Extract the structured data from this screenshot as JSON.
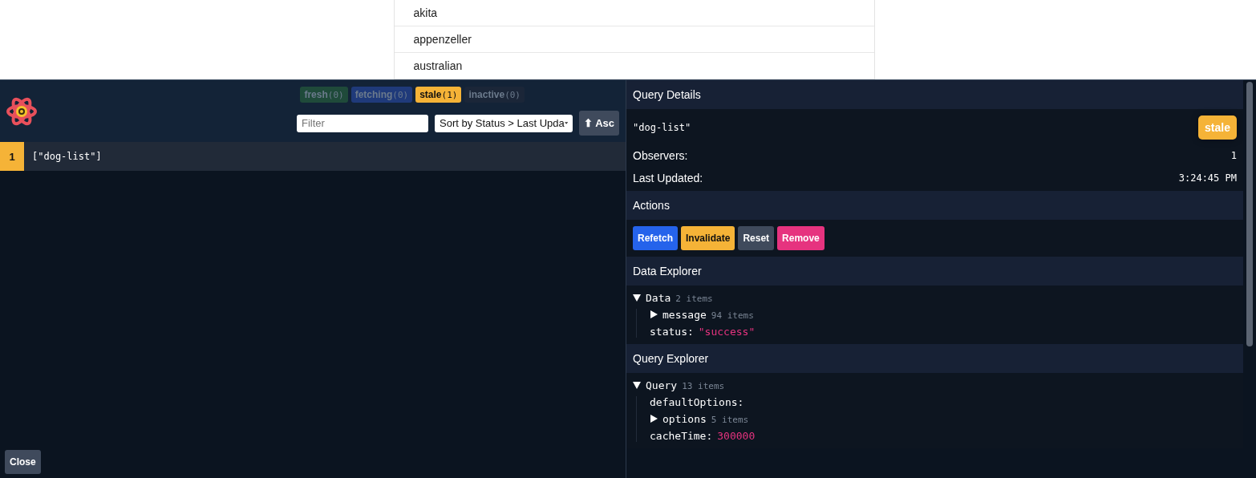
{
  "page_list": [
    "akita",
    "appenzeller",
    "australian"
  ],
  "devtools": {
    "status_chips": [
      {
        "label": "fresh",
        "count": "(0)",
        "color": "#1f4a3a",
        "dimmed": true
      },
      {
        "label": "fetching",
        "count": "(0)",
        "color": "#1f3a7a",
        "dimmed": true
      },
      {
        "label": "stale",
        "count": "(1)",
        "color": "#f5b337",
        "dimmed": false
      },
      {
        "label": "inactive",
        "count": "(0)",
        "color": "#1b2638",
        "dimmed": true
      }
    ],
    "filter": {
      "placeholder": "Filter"
    },
    "sort": {
      "value": "Sort by Status > Last Upda"
    },
    "order_button": "⬆ Asc",
    "queries": [
      {
        "observers": "1",
        "key": "[\"dog-list\"]",
        "color": "#f5b337",
        "selected": true
      }
    ],
    "close_button": "Close",
    "details": {
      "title": "Query Details",
      "key": "\"dog-list\"",
      "status": "stale",
      "rows": [
        {
          "label": "Observers:",
          "value": "1"
        },
        {
          "label": "Last Updated:",
          "value": "3:24:45 PM"
        }
      ]
    },
    "actions": {
      "title": "Actions",
      "buttons": [
        {
          "label": "Refetch",
          "color": "#2563eb"
        },
        {
          "label": "Invalidate",
          "color": "#f5b337"
        },
        {
          "label": "Reset",
          "color": "#3f4a5c"
        },
        {
          "label": "Remove",
          "color": "#e6337f"
        }
      ]
    },
    "explorers": [
      {
        "title": "Data Explorer",
        "tree": [
          {
            "key": "Data",
            "count": "2 items",
            "expanded": true,
            "children": [
              {
                "key": "message",
                "count": "94 items",
                "expanded": false
              },
              {
                "key": "status:",
                "value": "\"success\""
              }
            ]
          }
        ]
      },
      {
        "title": "Query Explorer",
        "tree": [
          {
            "key": "Query",
            "count": "13 items",
            "expanded": true,
            "children": [
              {
                "key": "defaultOptions:"
              },
              {
                "key": "options",
                "count": "5 items",
                "expanded": false
              },
              {
                "key": "cacheTime:",
                "value": "300000"
              }
            ]
          }
        ]
      }
    ]
  }
}
